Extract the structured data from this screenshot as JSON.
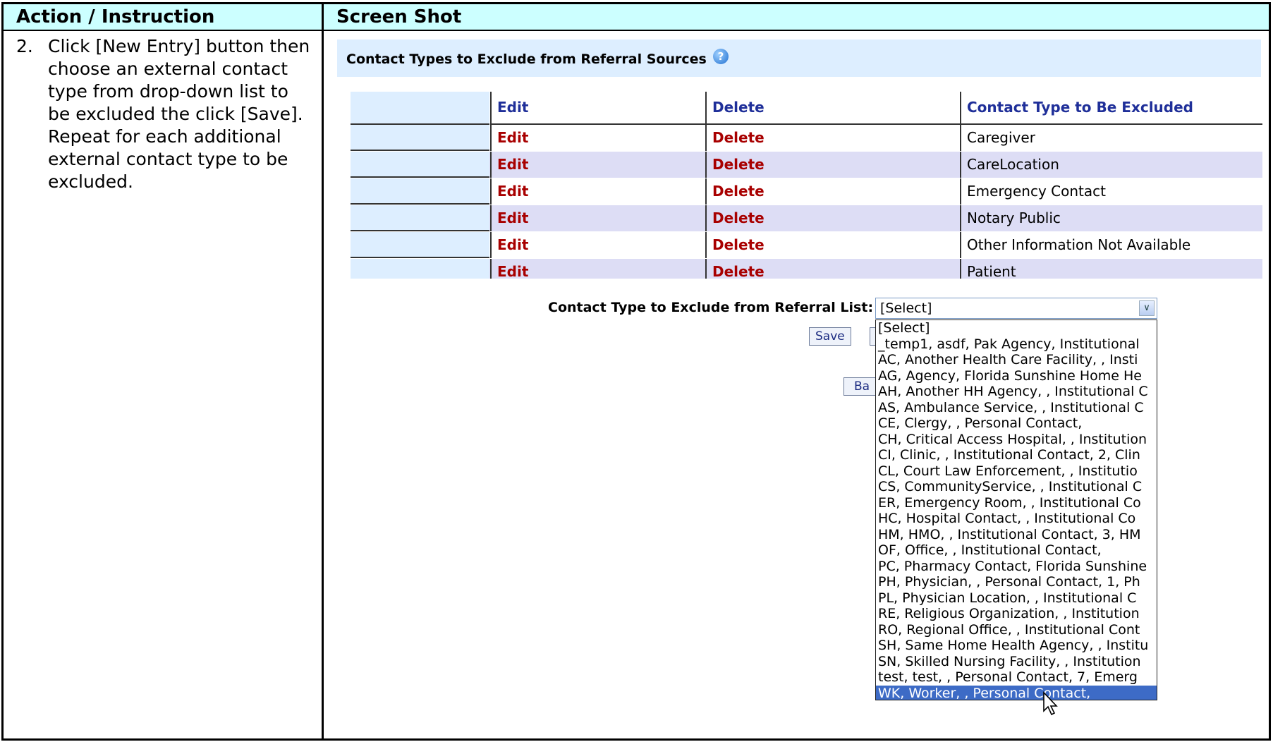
{
  "header": {
    "left": "Action / Instruction",
    "right": "Screen Shot"
  },
  "instruction": {
    "number": "2.",
    "text": "Click [New Entry] button then choose an external contact type from drop-down list to be excluded the click [Save].  Repeat for each additional external contact type to be excluded."
  },
  "panel": {
    "title": "Contact Types to Exclude from Referral Sources",
    "help_glyph": "?"
  },
  "table": {
    "headers": {
      "edit": "Edit",
      "delete": "Delete",
      "contact_type": "Contact Type to Be Excluded"
    },
    "rows": [
      {
        "edit": "Edit",
        "delete": "Delete",
        "contact_type": "Caregiver"
      },
      {
        "edit": "Edit",
        "delete": "Delete",
        "contact_type": "CareLocation"
      },
      {
        "edit": "Edit",
        "delete": "Delete",
        "contact_type": "Emergency Contact"
      },
      {
        "edit": "Edit",
        "delete": "Delete",
        "contact_type": "Notary Public"
      },
      {
        "edit": "Edit",
        "delete": "Delete",
        "contact_type": "Other Information Not Available"
      },
      {
        "edit": "Edit",
        "delete": "Delete",
        "contact_type": "Patient"
      }
    ]
  },
  "form": {
    "label": "Contact Type to Exclude from Referral List:",
    "selected": "[Select]",
    "save_label": "Save",
    "back_label": "Ba",
    "options": [
      "[Select]",
      "_temp1, asdf, Pak Agency, Institutional",
      "AC, Another Health Care Facility, , Insti",
      "AG, Agency, Florida Sunshine Home He",
      "AH, Another HH Agency, , Institutional C",
      "AS, Ambulance Service, , Institutional C",
      "CE, Clergy, , Personal Contact,",
      "CH, Critical Access Hospital, , Institution",
      "CI, Clinic, , Institutional Contact, 2, Clin",
      "CL, Court Law Enforcement, , Institutio",
      "CS, CommunityService, , Institutional C",
      "ER, Emergency Room, , Institutional Co",
      "HC, Hospital Contact, , Institutional Co",
      "HM, HMO, , Institutional Contact, 3, HM",
      "OF, Office, , Institutional Contact,",
      "PC, Pharmacy Contact, Florida Sunshine",
      "PH, Physician, , Personal Contact, 1, Ph",
      "PL, Physician Location, , Institutional C",
      "RE, Religious Organization, , Institution",
      "RO, Regional Office, , Institutional Cont",
      "SH, Same Home Health Agency, , Institu",
      "SN, Skilled Nursing Facility, , Institution",
      "test, test, , Personal Contact, 7, Emerg",
      "WK, Worker, , Personal Contact,"
    ],
    "highlighted_option": "WK, Worker, , Personal Contact,"
  },
  "colors": {
    "header_bg": "#ccffff",
    "panel_bg": "#ddeeff",
    "link_red": "#a80000",
    "header_blue": "#1f2f99",
    "highlight": "#3d6bc6"
  }
}
